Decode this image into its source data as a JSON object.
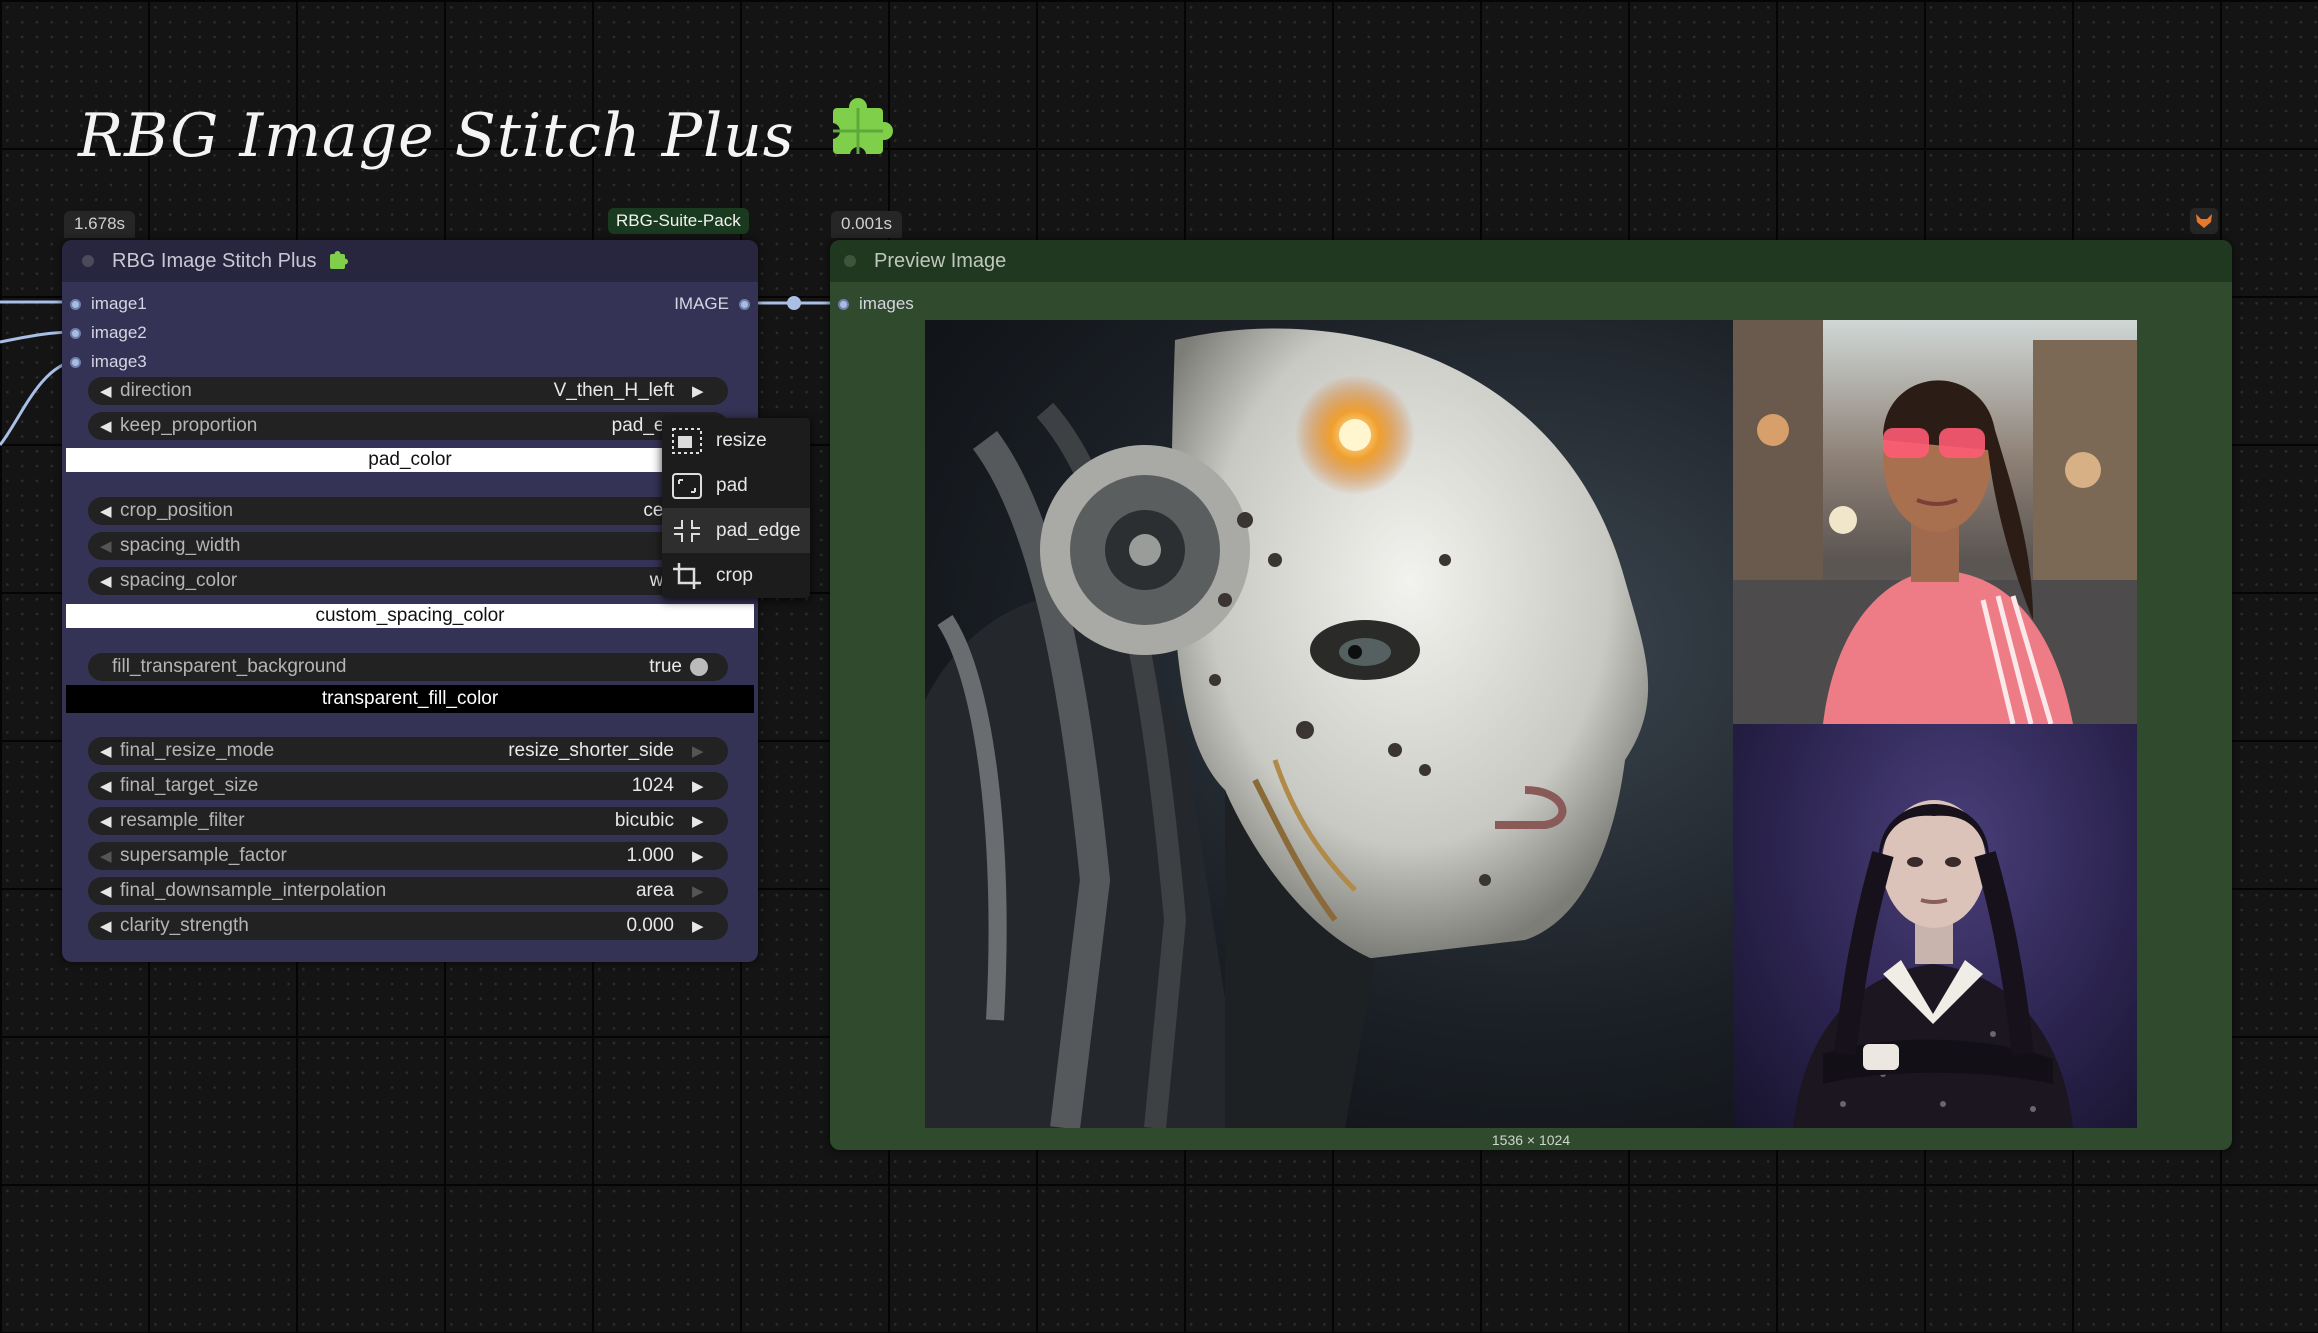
{
  "title": "RBG Image Stitch Plus",
  "stitch_node": {
    "timing": "1.678s",
    "pack_badge": "RBG-Suite-Pack",
    "header": "RBG Image Stitch Plus",
    "inputs": [
      "image1",
      "image2",
      "image3"
    ],
    "output": "IMAGE",
    "widgets": {
      "direction": {
        "label": "direction",
        "value": "V_then_H_left"
      },
      "keep_proportion": {
        "label": "keep_proportion",
        "value": "pad_ec"
      },
      "pad_color": "pad_color",
      "crop_position": {
        "label": "crop_position",
        "value": "cen"
      },
      "spacing_width": {
        "label": "spacing_width",
        "value": ""
      },
      "spacing_color": {
        "label": "spacing_color",
        "value": "wh"
      },
      "custom_spacing_color": "custom_spacing_color",
      "fill_transparent_background": {
        "label": "fill_transparent_background",
        "value": "true"
      },
      "transparent_fill_color": "transparent_fill_color",
      "final_resize_mode": {
        "label": "final_resize_mode",
        "value": "resize_shorter_side"
      },
      "final_target_size": {
        "label": "final_target_size",
        "value": "1024"
      },
      "resample_filter": {
        "label": "resample_filter",
        "value": "bicubic"
      },
      "supersample_factor": {
        "label": "supersample_factor",
        "value": "1.000"
      },
      "final_downsample_interpolation": {
        "label": "final_downsample_interpolation",
        "value": "area"
      },
      "clarity_strength": {
        "label": "clarity_strength",
        "value": "0.000"
      }
    }
  },
  "dropdown_menu": {
    "items": [
      "resize",
      "pad",
      "pad_edge",
      "crop"
    ],
    "highlighted": "pad_edge"
  },
  "preview_node": {
    "timing": "0.001s",
    "header": "Preview Image",
    "input": "images",
    "size_label": "1536 × 1024"
  },
  "colors": {
    "stitch_node_bg": "#353355",
    "preview_node_bg": "#2f4a2d",
    "wire": "#a9bfe6"
  }
}
